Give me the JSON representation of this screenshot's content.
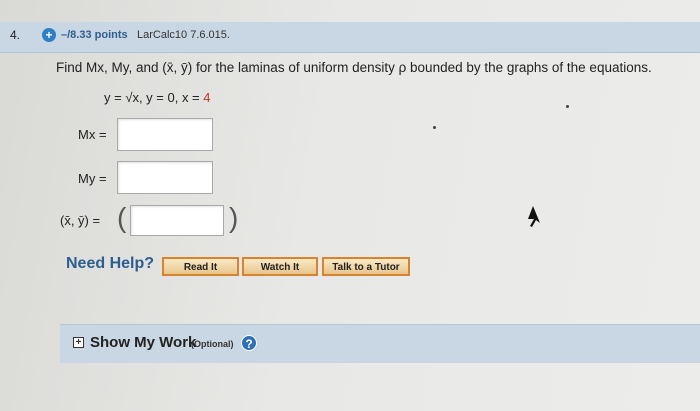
{
  "question": {
    "number": "4.",
    "points": "–/8.33 points",
    "source": "LarCalc10 7.6.015."
  },
  "prompt": "Find Mx, My, and (x̄, ȳ) for the laminas of uniform density ρ bounded by the graphs of the equations.",
  "equation": {
    "text": "y = √x, y = 0, x = ",
    "given_value": "4"
  },
  "answers": {
    "mx_label": "Mx =",
    "my_label": "My =",
    "centroid_label": "(x̄, ȳ) =",
    "mx_value": "",
    "my_value": "",
    "centroid_value": ""
  },
  "help": {
    "title": "Need Help?",
    "read_it": "Read It",
    "watch_it": "Watch It",
    "tutor": "Talk to a Tutor"
  },
  "show_my_work": {
    "toggle": "+",
    "title": "Show My Work",
    "optional": "(Optional)",
    "help_glyph": "?"
  },
  "colors": {
    "header_bar": "#c9d6e3",
    "link_blue": "#2c5f8f",
    "given_red": "#c0392b",
    "button_border": "#d9832c"
  }
}
